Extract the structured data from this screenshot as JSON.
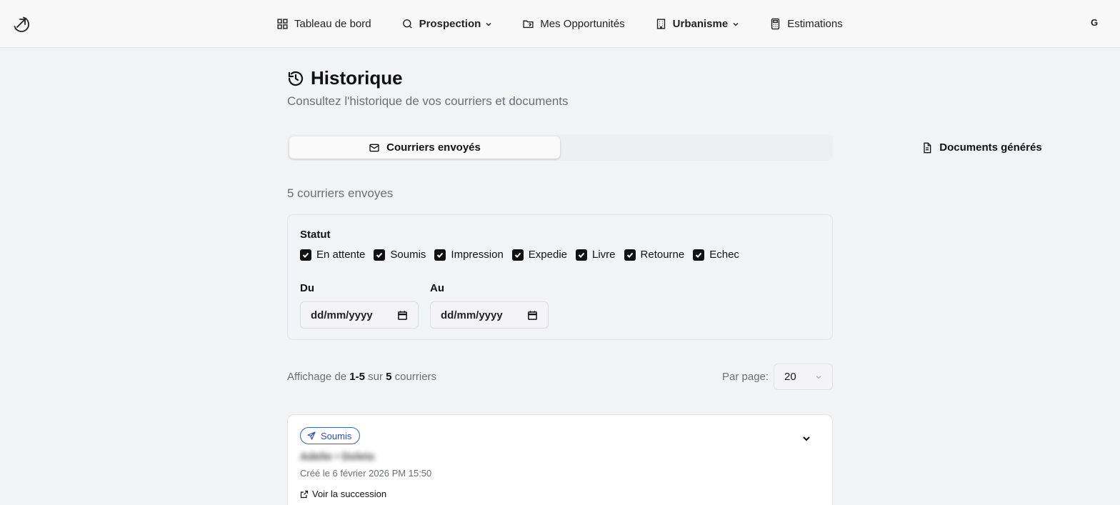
{
  "nav": {
    "items": [
      {
        "label": "Tableau de bord",
        "icon": "dashboard-icon"
      },
      {
        "label": "Prospection",
        "icon": "search-icon"
      },
      {
        "label": "Mes Opportunités",
        "icon": "folder-heart-icon"
      },
      {
        "label": "Urbanisme",
        "icon": "building-icon"
      },
      {
        "label": "Estimations",
        "icon": "calculator-icon"
      }
    ],
    "avatar": "G"
  },
  "header": {
    "title": "Historique",
    "subtitle": "Consultez l'historique de vos courriers et documents"
  },
  "tabs": [
    {
      "label": "Courriers envoyés",
      "active": true
    },
    {
      "label": "Documents générés",
      "active": false
    }
  ],
  "count_text": "5 courriers envoyes",
  "filters": {
    "status_label": "Statut",
    "statuses": [
      {
        "label": "En attente",
        "checked": true
      },
      {
        "label": "Soumis",
        "checked": true
      },
      {
        "label": "Impression",
        "checked": true
      },
      {
        "label": "Expedie",
        "checked": true
      },
      {
        "label": "Livre",
        "checked": true
      },
      {
        "label": "Retourne",
        "checked": true
      },
      {
        "label": "Echec",
        "checked": true
      }
    ],
    "from_label": "Du",
    "to_label": "Au",
    "from_value": "dd/mm/yyyy",
    "to_value": "dd/mm/yyyy"
  },
  "pagination": {
    "prefix": "Affichage de ",
    "range": "1-5",
    "middle": " sur ",
    "total": "5",
    "suffix": " courriers",
    "per_page_label": "Par page:",
    "per_page_value": "20"
  },
  "card": {
    "status": "Soumis",
    "name_blurred": "Adelie  •  Dolets",
    "created": "Créé le 6 février 2026 PM 15:50",
    "link": "Voir la succession"
  },
  "colors": {
    "background": "#f2f3f5",
    "badge_blue": "#2d4fb8"
  }
}
